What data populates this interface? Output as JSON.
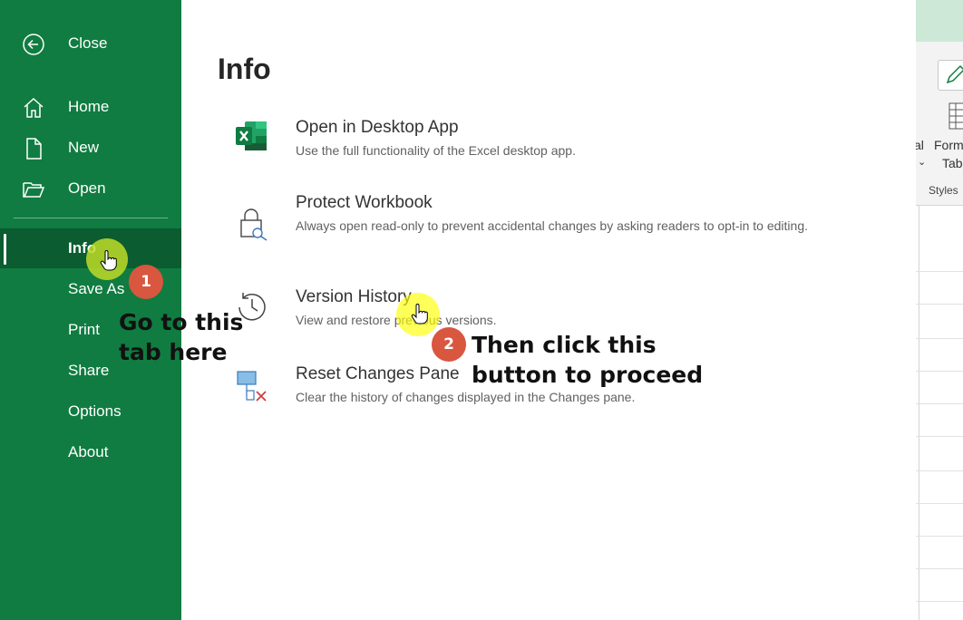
{
  "sidebar": {
    "items": [
      {
        "label": "Close",
        "icon": "back-arrow-icon"
      },
      {
        "label": "Home",
        "icon": "home-icon"
      },
      {
        "label": "New",
        "icon": "new-document-icon"
      },
      {
        "label": "Open",
        "icon": "open-folder-icon"
      },
      {
        "label": "Info",
        "active": true
      },
      {
        "label": "Save As"
      },
      {
        "label": "Print"
      },
      {
        "label": "Share"
      },
      {
        "label": "Options"
      },
      {
        "label": "About"
      }
    ],
    "background": "#107c41",
    "active_background": "#0b5c30"
  },
  "main": {
    "title": "Info",
    "options": [
      {
        "title": "Open in Desktop App",
        "description": "Use the full functionality of the Excel desktop app.",
        "icon": "excel-app-icon"
      },
      {
        "title": "Protect Workbook",
        "description": "Always open read-only to prevent accidental changes by asking readers to opt-in to editing.",
        "icon": "lock-key-icon"
      },
      {
        "title": "Version History",
        "description": "View and restore previous versions.",
        "icon": "history-clock-icon"
      },
      {
        "title": "Reset Changes Pane",
        "description": "Clear the history of changes displayed in the Changes pane.",
        "icon": "reset-pane-icon"
      }
    ]
  },
  "background_app": {
    "ribbon_texts": [
      "al",
      "Form",
      "Tab",
      "Styles"
    ]
  },
  "annotations": {
    "step1": {
      "number": "1",
      "text_line1": "Go to this",
      "text_line2": "tab here"
    },
    "step2": {
      "number": "2",
      "text_line1": "Then click this",
      "text_line2": "button to proceed"
    },
    "badge_color": "#d9563f",
    "highlight_color": "#ffff00"
  }
}
